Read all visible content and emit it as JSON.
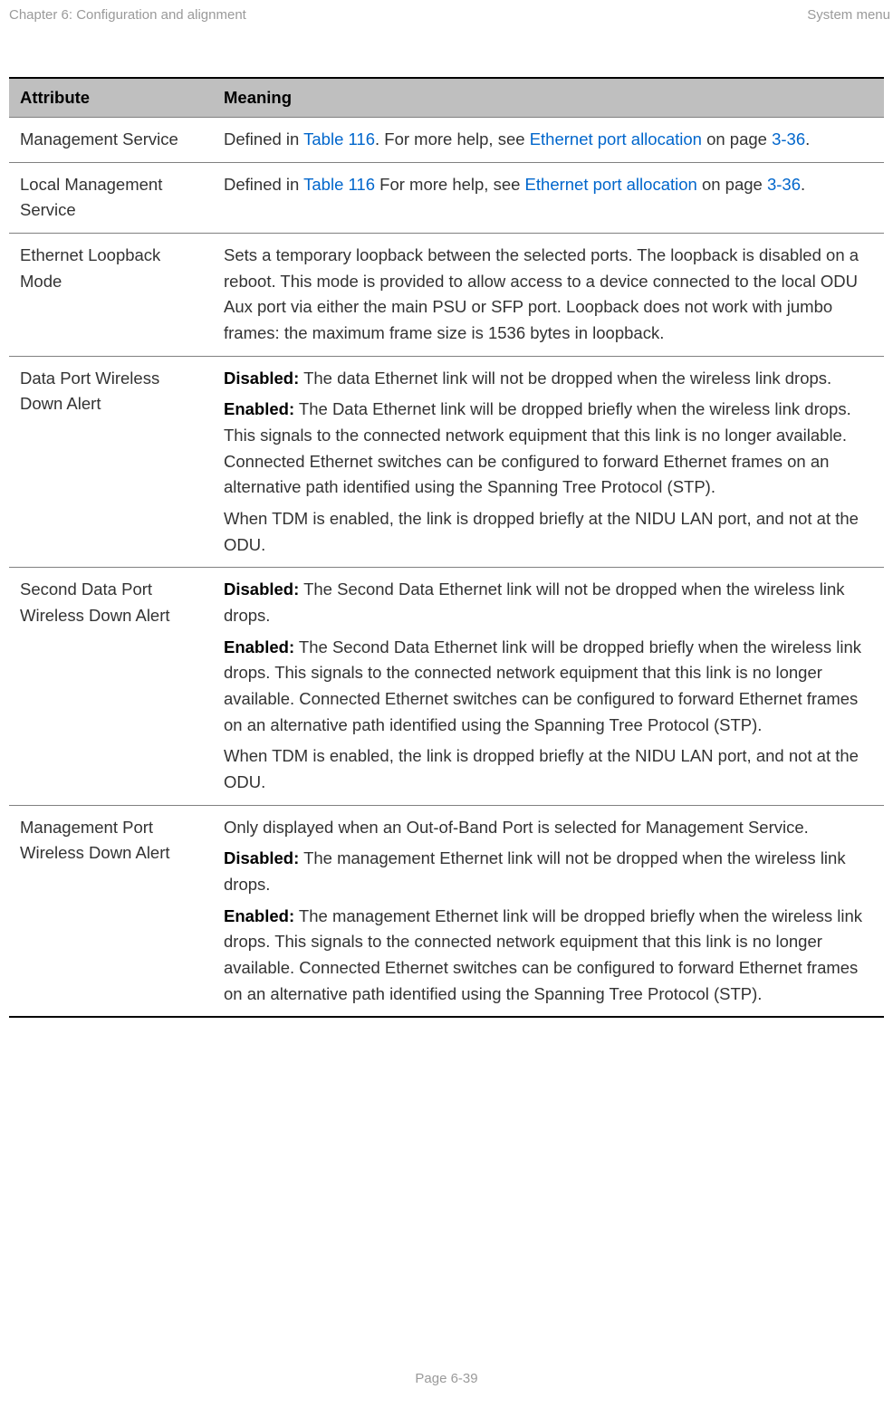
{
  "header": {
    "left": "Chapter 6:  Configuration and alignment",
    "right": "System menu"
  },
  "table": {
    "headers": {
      "attribute": "Attribute",
      "meaning": "Meaning"
    },
    "rows": {
      "r1": {
        "attr": "Management Service",
        "t1": "Defined in ",
        "link1": "Table 116",
        "t2": ". For more help, see ",
        "link2": "Ethernet port allocation",
        "t3": " on page ",
        "link3": "3-36",
        "t4": "."
      },
      "r2": {
        "attr": "Local Management Service",
        "t1": "Defined in ",
        "link1": "Table 116",
        "t2": " For more help, see ",
        "link2": "Ethernet port allocation",
        "t3": " on page ",
        "link3": "3-36",
        "t4": "."
      },
      "r3": {
        "attr": "Ethernet Loopback Mode",
        "p1": "Sets a temporary loopback between the selected ports. The loopback is disabled on a reboot. This mode is provided to allow access to a device connected to the local ODU Aux port via either the main PSU or SFP port. Loopback does not work with jumbo frames: the maximum frame size is 1536 bytes in loopback."
      },
      "r4": {
        "attr": "Data Port Wireless Down Alert",
        "b1": "Disabled:",
        "p1": " The data Ethernet link will not be dropped when the wireless link drops.",
        "b2": "Enabled:",
        "p2": " The Data Ethernet link will be dropped briefly when the wireless link drops. This signals to the connected network equipment that this link is no longer available. Connected Ethernet switches can be configured to forward Ethernet frames on an alternative path identified using the Spanning Tree Protocol (STP).",
        "p3": "When TDM is enabled, the link is dropped briefly at the NIDU LAN port, and not at the ODU."
      },
      "r5": {
        "attr": "Second Data Port Wireless Down Alert",
        "b1": "Disabled:",
        "p1": " The Second Data Ethernet link will not be dropped when the wireless link drops.",
        "b2": "Enabled:",
        "p2": " The Second Data Ethernet link will be dropped briefly when the wireless link drops. This signals to the connected network equipment that this link is no longer available. Connected Ethernet switches can be configured to forward Ethernet frames on an alternative path identified using the Spanning Tree Protocol (STP).",
        "p3": "When TDM is enabled, the link is dropped briefly at the NIDU LAN port, and not at the ODU."
      },
      "r6": {
        "attr": "Management Port Wireless Down Alert",
        "p0": "Only displayed when an Out-of-Band Port is selected for Management Service.",
        "b1": "Disabled:",
        "p1": " The management Ethernet link will not be dropped when the wireless link drops.",
        "b2": "Enabled:",
        "p2": " The management Ethernet link will be dropped briefly when the wireless link drops. This signals to the connected network equipment that this link is no longer available. Connected Ethernet switches can be configured to forward Ethernet frames on an alternative path identified using the Spanning Tree Protocol (STP)."
      }
    }
  },
  "footer": {
    "page": "Page 6-39"
  }
}
